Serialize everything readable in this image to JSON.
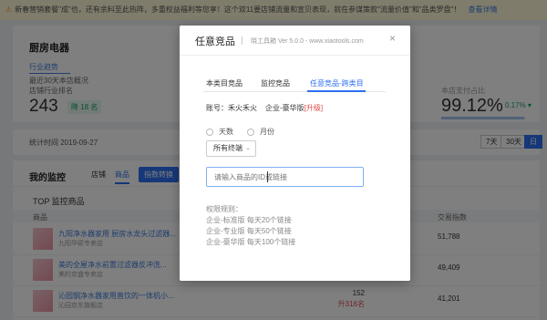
{
  "notice": {
    "text": "新春营销套餐\"成\"也，还有余料至此热阵，多重权益福利等您享！这个双11要店铺流量和宣贝表现，就在参谋策款\"流量价值\"和\"品类罗盘\"！",
    "link": "查看详情"
  },
  "shop": {
    "title": "厨房电器",
    "tab": "行业趋势",
    "sub": "最近30天本店概况",
    "sub2": "店铺行业排名",
    "rank": "243",
    "rank_change": "降 18 名",
    "pct_label": "本店支付占比",
    "pct": "99.12%",
    "pct_change": "0.17% ▾",
    "pct_fill": 0.9912
  },
  "date": {
    "label": "统计时间 2019-09-27",
    "ranges": [
      "7天",
      "30天",
      "日"
    ]
  },
  "monitor": {
    "title": "我的监控",
    "tabs": [
      "店铺",
      "商品"
    ],
    "button": "指数转换",
    "top_title": "TOP 监控商品",
    "headers": {
      "product": "商品",
      "index": "交易指数"
    },
    "rows": [
      {
        "title": "九阳净水器家用 厨房水龙头过滤器...",
        "shop": "九阳华硕专卖店",
        "value": "51,788",
        "mid": "",
        "mid2": ""
      },
      {
        "title": "美的全屋净水前置过滤器反冲洗...",
        "shop": "美的京盛专卖店",
        "value": "49,409",
        "mid": "",
        "mid2": ""
      },
      {
        "title": "沁园钢净水器家用直饮的一体机小...",
        "shop": "沁园京东旗舰店",
        "value": "41,201",
        "mid": "152",
        "mid2": "升316名"
      }
    ]
  },
  "modal": {
    "title": "任意竞品",
    "subtitle": "晓工具箱  Ver 5.0.0 - www.xiaotools.com",
    "close": "×",
    "tabs": [
      "本类目竞品",
      "监控竞品",
      "任意竞品-跨类目"
    ],
    "active_tab": 2,
    "account_label": "账号：禾火禾火",
    "plan": "企业-豪华版",
    "upgrade": "[升级]",
    "radios": [
      "天数",
      "月份"
    ],
    "select_value": "所有终端",
    "input_placeholder": "请输入商品的ID或链接",
    "rules_title": "权限规则：",
    "rules": [
      "企业-标准版 每天20个链接",
      "企业-专业版 每天50个链接",
      "企业-豪华版 每天100个链接"
    ]
  }
}
